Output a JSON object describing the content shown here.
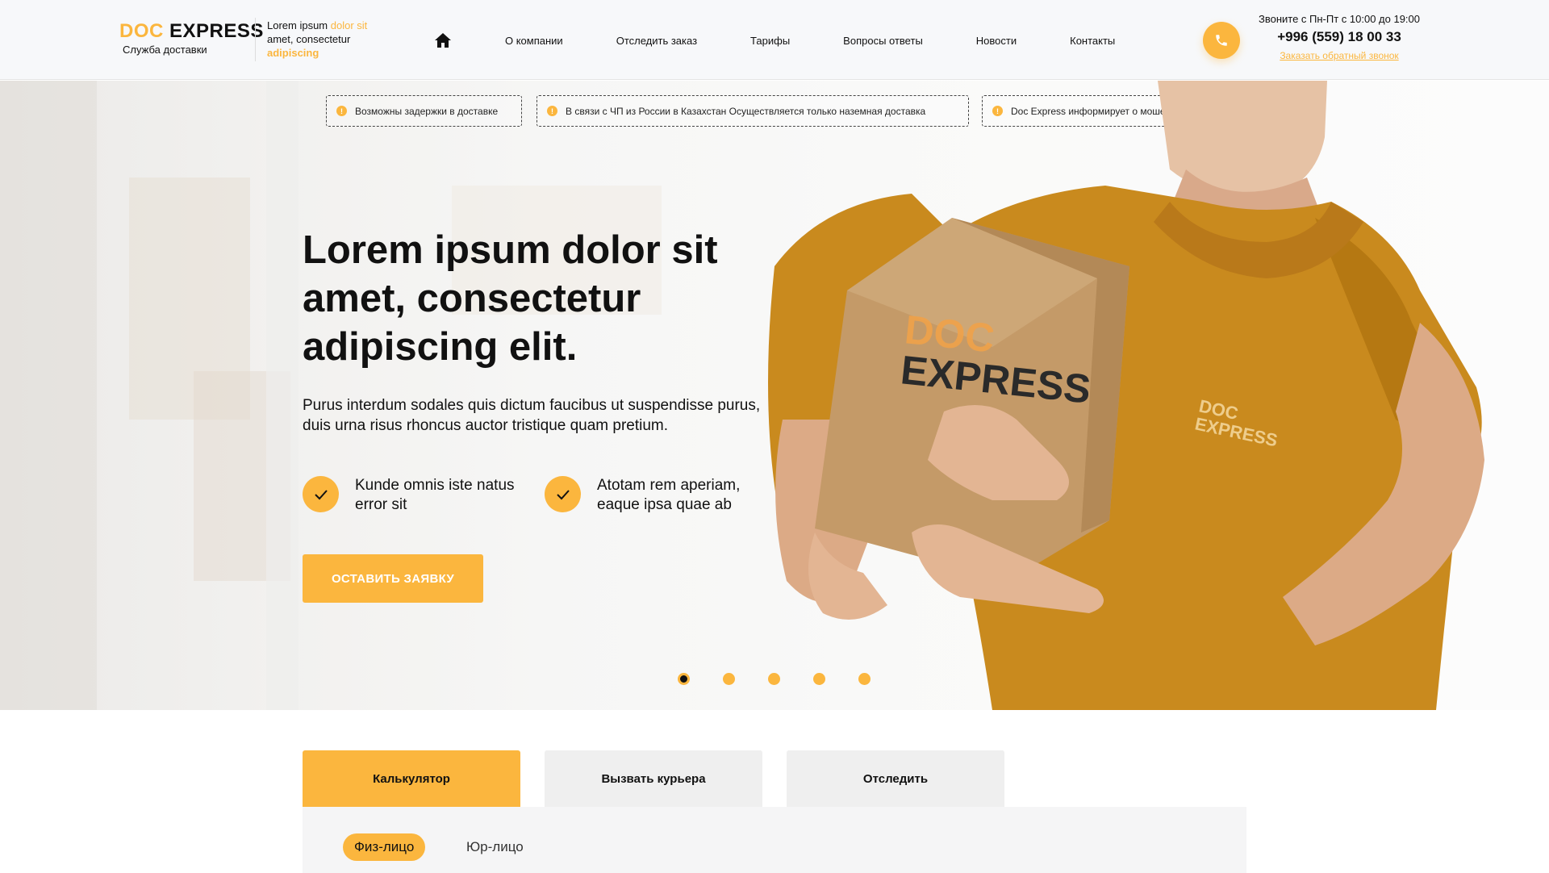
{
  "header": {
    "logo": {
      "doc": "DOC",
      "express": "EXPRESS",
      "subtitle": "Служба доставки"
    },
    "tagline": {
      "part1": "Lorem ipsum ",
      "part2": "dolor sit",
      "part3": " amet, consectetur ",
      "part4": "adipiscing"
    },
    "nav": [
      "О компании",
      "Отследить заказ",
      "Тарифы",
      "Вопросы ответы",
      "Новости",
      "Контакты"
    ],
    "contact": {
      "hours": "Звоните с Пн-Пт с 10:00 до 19:00",
      "phone": "+996 (559) 18 00 33",
      "callback": "Заказать обратный звонок"
    }
  },
  "notices": [
    "Возможны задержки в доставке",
    "В связи с ЧП из России в Казахстан Осуществляется только наземная доставка",
    "Doc Express информирует о мошенниках"
  ],
  "hero": {
    "title": "Lorem ipsum dolor sit amet, consectetur adipiscing elit.",
    "text": "Purus interdum sodales quis dictum faucibus ut suspendisse purus, duis urna risus rhoncus auctor tristique quam pretium.",
    "features": [
      "Kunde omnis iste natus error sit",
      "Atotam rem aperiam, eaque ipsa quae ab"
    ],
    "cta": "ОСТАВИТЬ ЗАЯВКУ",
    "box_text": {
      "doc": "DOC",
      "express": "EXPRESS"
    },
    "shirt_text": {
      "doc": "DOC",
      "express": "EXPRESS"
    },
    "slides": {
      "count": 5,
      "active": 1
    }
  },
  "tabs": [
    "Калькулятор",
    "Вызвать курьера",
    "Отследить"
  ],
  "client_types": [
    "Физ-лицо",
    "Юр-лицо"
  ],
  "colors": {
    "accent": "#fbb63e",
    "shirt": "#c98a1e",
    "box": "#c9a06c"
  }
}
